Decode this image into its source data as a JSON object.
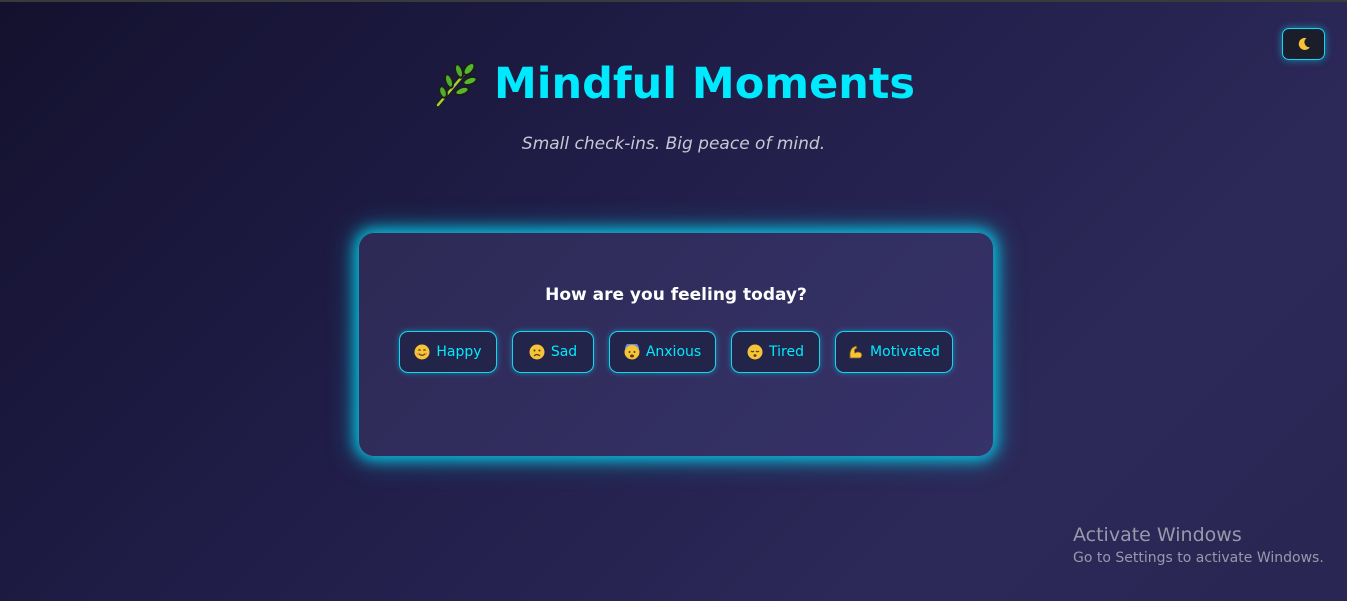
{
  "header": {
    "title": "Mindful Moments",
    "title_icon": "leaf-icon",
    "subtitle": "Small check-ins. Big peace of mind."
  },
  "theme_toggle": {
    "icon": "moon-icon"
  },
  "mood_card": {
    "question": "How are you feeling today?",
    "moods": [
      {
        "label": "Happy",
        "icon": "smiling-face-icon"
      },
      {
        "label": "Sad",
        "icon": "sad-face-icon"
      },
      {
        "label": "Anxious",
        "icon": "anxious-face-icon"
      },
      {
        "label": "Tired",
        "icon": "sleeping-face-icon"
      },
      {
        "label": "Motivated",
        "icon": "flexed-biceps-icon"
      }
    ]
  },
  "os_watermark": {
    "title": "Activate Windows",
    "subtitle": "Go to Settings to activate Windows."
  },
  "colors": {
    "accent": "#00eaff",
    "background": "#201d48",
    "card": "#322e62"
  }
}
